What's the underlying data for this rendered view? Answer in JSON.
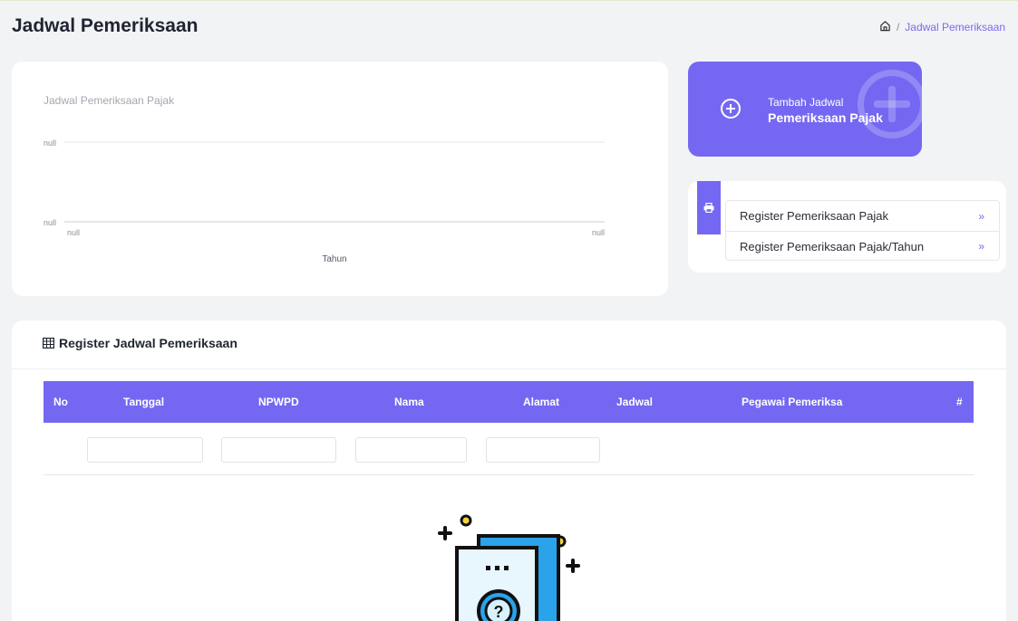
{
  "header": {
    "title": "Jadwal Pemeriksaan",
    "breadcrumb": {
      "separator": "/",
      "current": "Jadwal Pemeriksaan"
    }
  },
  "chart": {
    "title": "Jadwal Pemeriksaan Pajak",
    "xlabel": "Tahun",
    "ytick_top": "null",
    "ytick_bottom": "null",
    "xtick_left": "null",
    "xtick_right": "null"
  },
  "chart_data": {
    "type": "line",
    "title": "Jadwal Pemeriksaan Pajak",
    "xlabel": "Tahun",
    "ylabel": "",
    "categories": [
      "null",
      "null"
    ],
    "yticks": [
      "null",
      "null"
    ],
    "series": [],
    "grid": true
  },
  "add_button": {
    "line1": "Tambah Jadwal",
    "line2": "Pemeriksaan Pajak"
  },
  "register_links": [
    {
      "label": "Register Pemeriksaan Pajak",
      "chevron": "»"
    },
    {
      "label": "Register Pemeriksaan Pajak/Tahun",
      "chevron": "»"
    }
  ],
  "table": {
    "title": "Register Jadwal Pemeriksaan",
    "columns": [
      "No",
      "Tanggal",
      "NPWPD",
      "Nama",
      "Alamat",
      "Jadwal",
      "Pegawai Pemeriksa",
      "#"
    ],
    "filters": [
      "",
      "",
      "",
      ""
    ],
    "rows": []
  },
  "colors": {
    "accent": "#7468f2",
    "background": "#f2f3f5"
  },
  "icons": [
    "home-icon",
    "plus-circle-icon",
    "printer-icon",
    "table-grid-icon",
    "chevron-double-right-icon",
    "empty-state-illustration"
  ]
}
